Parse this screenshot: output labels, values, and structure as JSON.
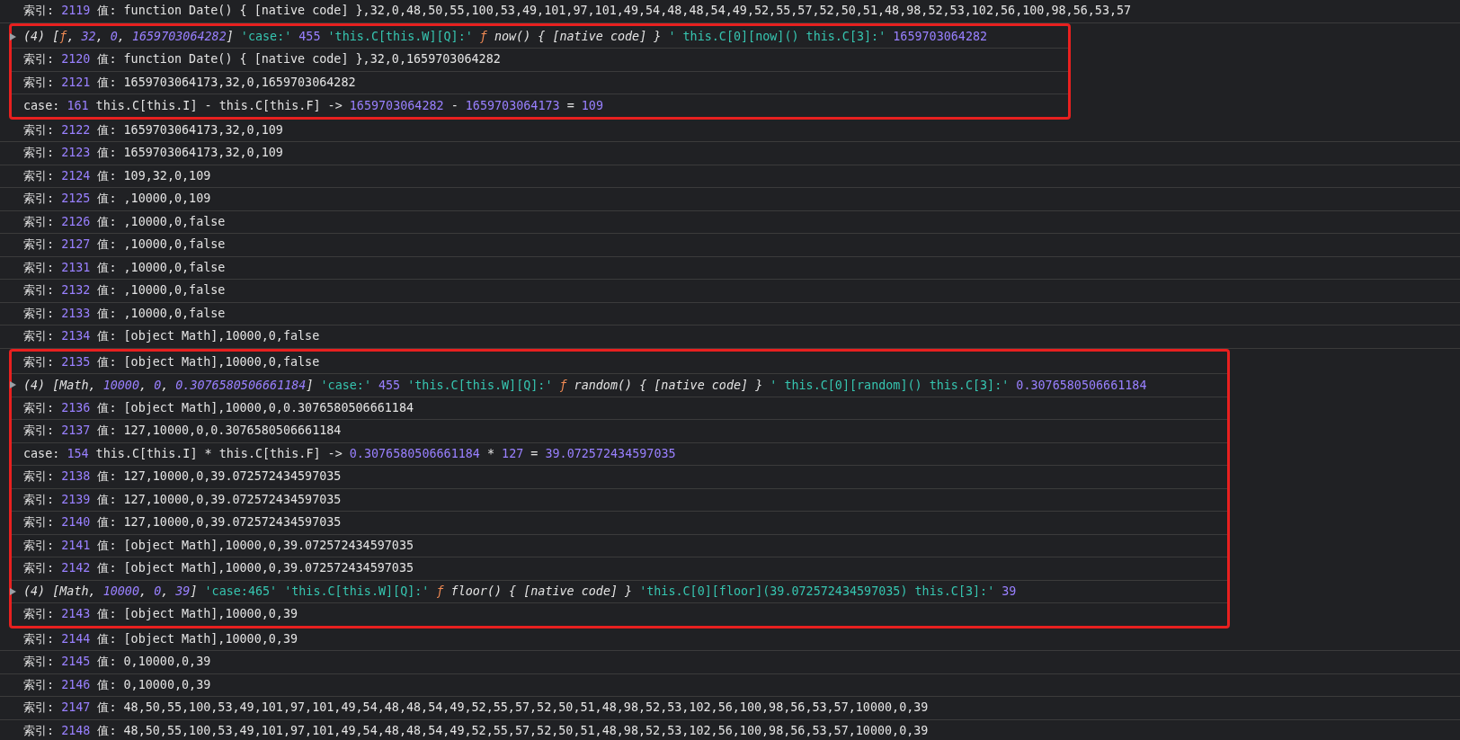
{
  "console": {
    "groups": [
      {
        "annotated": false,
        "rows": [
          {
            "kind": "message",
            "key_label": "索引:",
            "index": "2119",
            "value_label": "值:",
            "value": "function Date() { [native code] },32,0,48,50,55,100,53,49,101,97,101,49,54,48,48,54,49,52,55,57,52,50,51,48,98,52,53,102,56,100,98,56,53,57"
          }
        ]
      },
      {
        "annotated": true,
        "rows": [
          {
            "kind": "log",
            "expanded": false,
            "preview": [
              {
                "kind": "text",
                "text": "(4) ["
              },
              {
                "kind": "function",
                "text": "ƒ"
              },
              {
                "kind": "text",
                "text": ", "
              },
              {
                "kind": "number",
                "text": "32"
              },
              {
                "kind": "text",
                "text": ", "
              },
              {
                "kind": "number",
                "text": "0"
              },
              {
                "kind": "text",
                "text": ", "
              },
              {
                "kind": "number",
                "text": "1659703064282"
              },
              {
                "kind": "text",
                "text": "]"
              }
            ],
            "args": [
              {
                "kind": "string",
                "text": "'case:'"
              },
              {
                "kind": "number",
                "text": "455"
              },
              {
                "kind": "string",
                "text": "'this.C[this.W][Q]:'"
              },
              {
                "kind": "function",
                "sign": "ƒ",
                "text": "now() { [native code] }"
              },
              {
                "kind": "string",
                "text": "' this.C[0][now]() this.C[3]:'"
              },
              {
                "kind": "number",
                "text": "1659703064282"
              }
            ]
          },
          {
            "kind": "message",
            "key_label": "索引:",
            "index": "2120",
            "value_label": "值:",
            "value": "function Date() { [native code] },32,0,1659703064282"
          },
          {
            "kind": "message",
            "key_label": "索引:",
            "index": "2121",
            "value_label": "值:",
            "value": "1659703064173,32,0,1659703064282"
          },
          {
            "kind": "case",
            "parts": [
              {
                "kind": "text",
                "text": "case: "
              },
              {
                "kind": "number",
                "text": "161"
              },
              {
                "kind": "text",
                "text": " this.C[this.I] - this.C[this.F] -> "
              },
              {
                "kind": "number",
                "text": "1659703064282"
              },
              {
                "kind": "text",
                "text": " - "
              },
              {
                "kind": "number",
                "text": "1659703064173"
              },
              {
                "kind": "text",
                "text": " = "
              },
              {
                "kind": "number",
                "text": "109"
              }
            ]
          }
        ]
      },
      {
        "annotated": false,
        "rows": [
          {
            "kind": "message",
            "key_label": "索引:",
            "index": "2122",
            "value_label": "值:",
            "value": "1659703064173,32,0,109"
          },
          {
            "kind": "message",
            "key_label": "索引:",
            "index": "2123",
            "value_label": "值:",
            "value": "1659703064173,32,0,109"
          },
          {
            "kind": "message",
            "key_label": "索引:",
            "index": "2124",
            "value_label": "值:",
            "value": "109,32,0,109"
          },
          {
            "kind": "message",
            "key_label": "索引:",
            "index": "2125",
            "value_label": "值:",
            "value": ",10000,0,109"
          },
          {
            "kind": "message",
            "key_label": "索引:",
            "index": "2126",
            "value_label": "值:",
            "value": ",10000,0,false"
          },
          {
            "kind": "message",
            "key_label": "索引:",
            "index": "2127",
            "value_label": "值:",
            "value": ",10000,0,false"
          },
          {
            "kind": "message",
            "key_label": "索引:",
            "index": "2131",
            "value_label": "值:",
            "value": ",10000,0,false"
          },
          {
            "kind": "message",
            "key_label": "索引:",
            "index": "2132",
            "value_label": "值:",
            "value": ",10000,0,false"
          },
          {
            "kind": "message",
            "key_label": "索引:",
            "index": "2133",
            "value_label": "值:",
            "value": ",10000,0,false"
          },
          {
            "kind": "message",
            "key_label": "索引:",
            "index": "2134",
            "value_label": "值:",
            "value": "[object Math],10000,0,false"
          }
        ]
      },
      {
        "annotated": true,
        "rows": [
          {
            "kind": "message",
            "key_label": "索引:",
            "index": "2135",
            "value_label": "值:",
            "value": "[object Math],10000,0,false"
          },
          {
            "kind": "log",
            "expanded": false,
            "preview": [
              {
                "kind": "text",
                "text": "(4) [Math, "
              },
              {
                "kind": "number",
                "text": "10000"
              },
              {
                "kind": "text",
                "text": ", "
              },
              {
                "kind": "number",
                "text": "0"
              },
              {
                "kind": "text",
                "text": ", "
              },
              {
                "kind": "number",
                "text": "0.3076580506661184"
              },
              {
                "kind": "text",
                "text": "]"
              }
            ],
            "args": [
              {
                "kind": "string",
                "text": "'case:'"
              },
              {
                "kind": "number",
                "text": "455"
              },
              {
                "kind": "string",
                "text": "'this.C[this.W][Q]:'"
              },
              {
                "kind": "function",
                "sign": "ƒ",
                "text": "random() { [native code] }"
              },
              {
                "kind": "string",
                "text": "' this.C[0][random]() this.C[3]:'"
              },
              {
                "kind": "number",
                "text": "0.3076580506661184"
              }
            ]
          },
          {
            "kind": "message",
            "key_label": "索引:",
            "index": "2136",
            "value_label": "值:",
            "value": "[object Math],10000,0,0.3076580506661184"
          },
          {
            "kind": "message",
            "key_label": "索引:",
            "index": "2137",
            "value_label": "值:",
            "value": "127,10000,0,0.3076580506661184"
          },
          {
            "kind": "case",
            "parts": [
              {
                "kind": "text",
                "text": "case: "
              },
              {
                "kind": "number",
                "text": "154"
              },
              {
                "kind": "text",
                "text": " this.C[this.I] * this.C[this.F] -> "
              },
              {
                "kind": "number",
                "text": "0.3076580506661184"
              },
              {
                "kind": "text",
                "text": " * "
              },
              {
                "kind": "number",
                "text": "127"
              },
              {
                "kind": "text",
                "text": " = "
              },
              {
                "kind": "number",
                "text": "39.072572434597035"
              }
            ]
          },
          {
            "kind": "message",
            "key_label": "索引:",
            "index": "2138",
            "value_label": "值:",
            "value": "127,10000,0,39.072572434597035"
          },
          {
            "kind": "message",
            "key_label": "索引:",
            "index": "2139",
            "value_label": "值:",
            "value": "127,10000,0,39.072572434597035"
          },
          {
            "kind": "message",
            "key_label": "索引:",
            "index": "2140",
            "value_label": "值:",
            "value": "127,10000,0,39.072572434597035"
          },
          {
            "kind": "message",
            "key_label": "索引:",
            "index": "2141",
            "value_label": "值:",
            "value": "[object Math],10000,0,39.072572434597035"
          },
          {
            "kind": "message",
            "key_label": "索引:",
            "index": "2142",
            "value_label": "值:",
            "value": "[object Math],10000,0,39.072572434597035"
          },
          {
            "kind": "log",
            "expanded": false,
            "preview": [
              {
                "kind": "text",
                "text": "(4) [Math, "
              },
              {
                "kind": "number",
                "text": "10000"
              },
              {
                "kind": "text",
                "text": ", "
              },
              {
                "kind": "number",
                "text": "0"
              },
              {
                "kind": "text",
                "text": ", "
              },
              {
                "kind": "number",
                "text": "39"
              },
              {
                "kind": "text",
                "text": "]"
              }
            ],
            "args": [
              {
                "kind": "string",
                "text": "'case:465'"
              },
              {
                "kind": "string",
                "text": "'this.C[this.W][Q]:'"
              },
              {
                "kind": "function",
                "sign": "ƒ",
                "text": "floor() { [native code] }"
              },
              {
                "kind": "string",
                "text": "'this.C[0][floor](39.072572434597035) this.C[3]:'"
              },
              {
                "kind": "number",
                "text": "39"
              }
            ]
          },
          {
            "kind": "message",
            "key_label": "索引:",
            "index": "2143",
            "value_label": "值:",
            "value": "[object Math],10000,0,39"
          }
        ]
      },
      {
        "annotated": false,
        "rows": [
          {
            "kind": "message",
            "key_label": "索引:",
            "index": "2144",
            "value_label": "值:",
            "value": "[object Math],10000,0,39"
          },
          {
            "kind": "message",
            "key_label": "索引:",
            "index": "2145",
            "value_label": "值:",
            "value": "0,10000,0,39"
          },
          {
            "kind": "message",
            "key_label": "索引:",
            "index": "2146",
            "value_label": "值:",
            "value": "0,10000,0,39"
          },
          {
            "kind": "message",
            "key_label": "索引:",
            "index": "2147",
            "value_label": "值:",
            "value": "48,50,55,100,53,49,101,97,101,49,54,48,48,54,49,52,55,57,52,50,51,48,98,52,53,102,56,100,98,56,53,57,10000,0,39"
          },
          {
            "kind": "message",
            "key_label": "索引:",
            "index": "2148",
            "value_label": "值:",
            "value": "48,50,55,100,53,49,101,97,101,49,54,48,48,54,49,52,55,57,52,50,51,48,98,52,53,102,56,100,98,56,53,57,10000,0,39"
          }
        ]
      }
    ]
  }
}
